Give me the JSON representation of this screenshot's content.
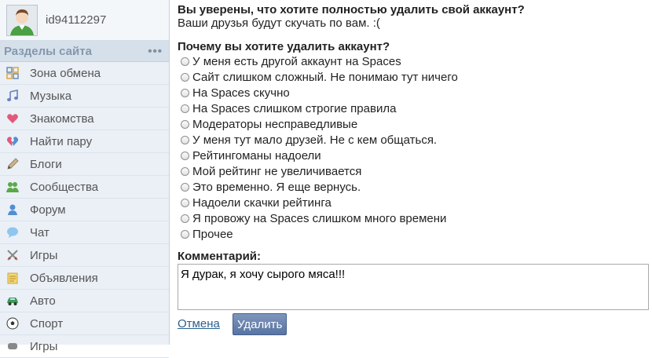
{
  "profile": {
    "user_id": "id94112297"
  },
  "sidebar": {
    "title": "Разделы сайта",
    "more": "•••",
    "items": [
      {
        "label": "Зона обмена",
        "icon": "exchange-grid-icon"
      },
      {
        "label": "Музыка",
        "icon": "music-note-icon"
      },
      {
        "label": "Знакомства",
        "icon": "heart-icon"
      },
      {
        "label": "Найти пару",
        "icon": "broken-heart-icon"
      },
      {
        "label": "Блоги",
        "icon": "pencil-icon"
      },
      {
        "label": "Сообщества",
        "icon": "people-icon"
      },
      {
        "label": "Форум",
        "icon": "forum-user-icon"
      },
      {
        "label": "Чат",
        "icon": "chat-bubble-icon"
      },
      {
        "label": "Игры",
        "icon": "crossed-swords-icon"
      },
      {
        "label": "Объявления",
        "icon": "notepad-icon"
      },
      {
        "label": "Авто",
        "icon": "car-icon"
      },
      {
        "label": "Спорт",
        "icon": "soccer-ball-icon"
      },
      {
        "label": "Игры",
        "icon": "game-icon"
      }
    ]
  },
  "dialog": {
    "title": "Вы уверены, что хотите полностью удалить свой аккаунт?",
    "subtitle": "Ваши друзья будут скучать по вам. :(",
    "reason_title": "Почему вы хотите удалить аккаунт?",
    "reasons": [
      "У меня есть другой аккаунт на Spaces",
      "Сайт слишком сложный. Не понимаю тут ничего",
      "На Spaces скучно",
      "На Spaces слишком строгие правила",
      "Модераторы несправедливые",
      "У меня тут мало друзей. Не с кем общаться.",
      "Рейтингоманы надоели",
      "Мой рейтинг не увеличивается",
      "Это временно. Я еще вернусь.",
      "Надоели скачки рейтинга",
      "Я провожу на Spaces слишком много времени",
      "Прочее"
    ],
    "comment_title": "Комментарий:",
    "comment_value": "Я дурак, я хочу сырого мяса!!!",
    "cancel_label": "Отмена",
    "delete_label": "Удалить"
  },
  "colors": {
    "sidebar_bg": "#eaf0f6",
    "section_head": "#d6e0ea",
    "link": "#2a5f8f",
    "button": "#5874a3"
  }
}
